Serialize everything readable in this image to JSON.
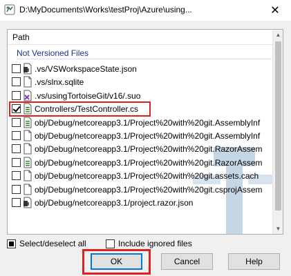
{
  "window": {
    "title": "D:\\MyDocuments\\Works\\testProj\\Azure\\using...",
    "close_label": "✕"
  },
  "list": {
    "column_header": "Path",
    "group_title": "Not Versioned Files",
    "items": [
      {
        "checked": false,
        "icon": "json-file-icon",
        "path": ".vs/VSWorkspaceState.json"
      },
      {
        "checked": false,
        "icon": "file-icon",
        "path": ".vs/slnx.sqlite"
      },
      {
        "checked": false,
        "icon": "suo-file-icon",
        "path": ".vs/usingTortoiseGit/v16/.suo"
      },
      {
        "checked": true,
        "icon": "cs-file-icon",
        "path": "Controllers/TestController.cs"
      },
      {
        "checked": false,
        "icon": "cs-file-icon",
        "path": "obj/Debug/netcoreapp3.1/Project%20with%20git.AssemblyInf"
      },
      {
        "checked": false,
        "icon": "file-icon",
        "path": "obj/Debug/netcoreapp3.1/Project%20with%20git.AssemblyInf"
      },
      {
        "checked": false,
        "icon": "file-icon",
        "path": "obj/Debug/netcoreapp3.1/Project%20with%20git.RazorAssem"
      },
      {
        "checked": false,
        "icon": "cs-file-icon",
        "path": "obj/Debug/netcoreapp3.1/Project%20with%20git.RazorAssem"
      },
      {
        "checked": false,
        "icon": "file-icon",
        "path": "obj/Debug/netcoreapp3.1/Project%20with%20git.assets.cach"
      },
      {
        "checked": false,
        "icon": "file-icon",
        "path": "obj/Debug/netcoreapp3.1/Project%20with%20git.csprojAssem"
      },
      {
        "checked": false,
        "icon": "json-file-icon",
        "path": "obj/Debug/netcoreapp3.1/project.razor.json"
      }
    ]
  },
  "options": {
    "select_all_label": "Select/deselect all",
    "select_all_state": "indeterminate",
    "include_ignored_label": "Include ignored files",
    "include_ignored_checked": false
  },
  "buttons": {
    "ok": "OK",
    "cancel": "Cancel",
    "help": "Help"
  },
  "colors": {
    "highlight": "#e02020",
    "group_title": "#1e3287",
    "default_button_border": "#0078d7"
  }
}
